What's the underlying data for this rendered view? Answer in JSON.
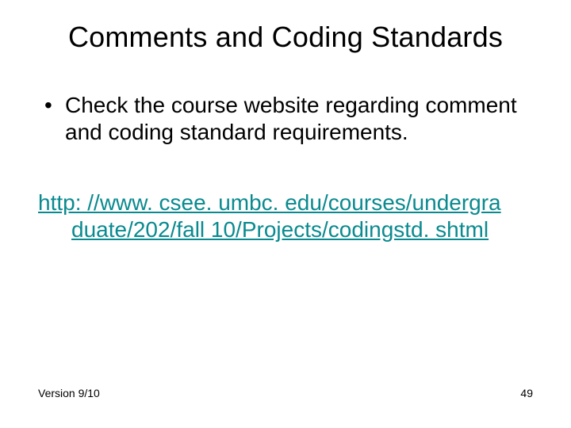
{
  "title": "Comments and Coding Standards",
  "bullet1": "Check the course website regarding comment and coding standard requirements.",
  "link": {
    "line1": "http: //www. csee. umbc. edu/courses/undergra",
    "line2": "duate/202/fall 10/Projects/codingstd. shtml",
    "color": "#0a8a8f"
  },
  "footer": {
    "version": "Version 9/10",
    "page": "49"
  }
}
